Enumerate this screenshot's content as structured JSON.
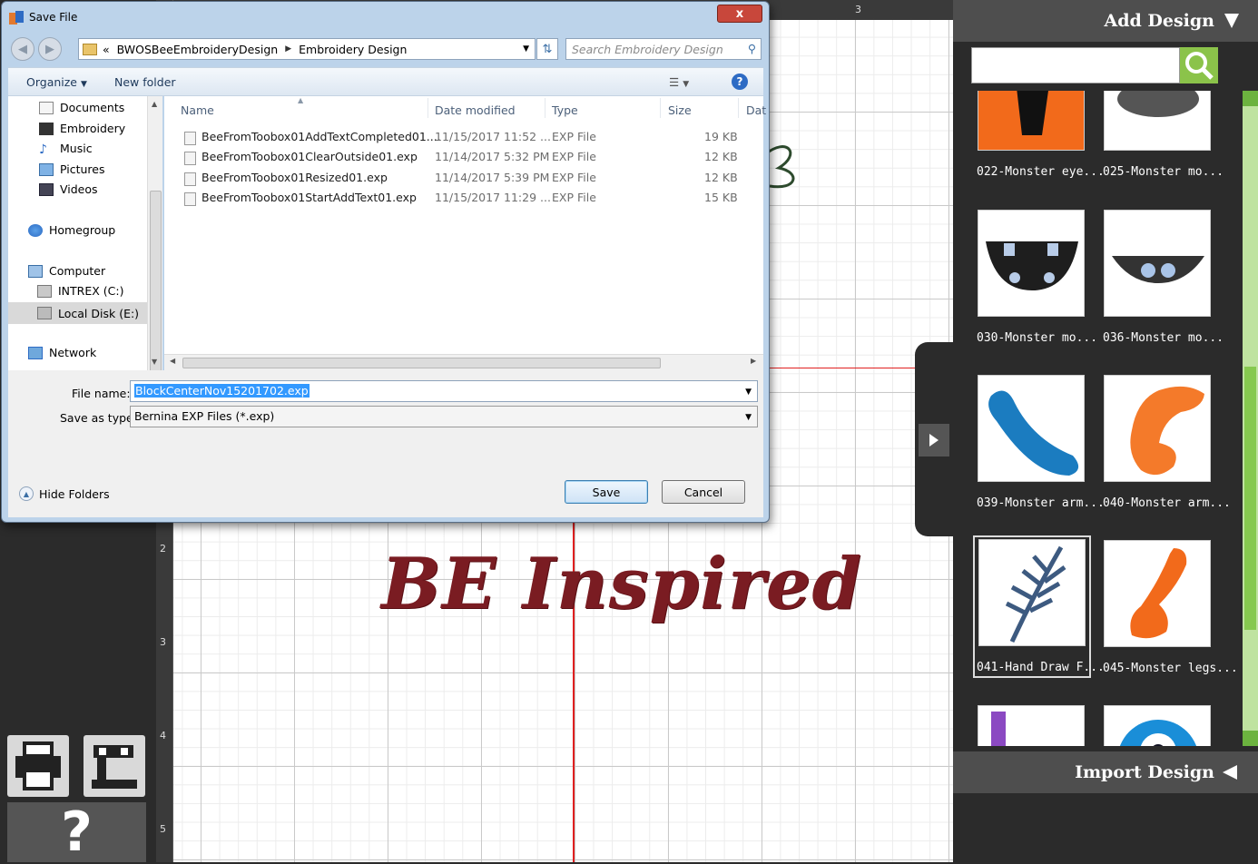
{
  "dialog": {
    "title": "Save File",
    "close_label": "x",
    "address": {
      "prefix": "«",
      "crumbs": [
        "BWOSBeeEmbroideryDesign",
        "Embroidery Design"
      ]
    },
    "search_placeholder": "Search Embroidery Design",
    "toolbar": {
      "organize": "Organize",
      "new_folder": "New folder"
    },
    "nav_items": [
      {
        "label": "Documents",
        "icon": "documents-icon"
      },
      {
        "label": "Embroidery",
        "icon": "embroidery-folder-icon"
      },
      {
        "label": "Music",
        "icon": "music-icon"
      },
      {
        "label": "Pictures",
        "icon": "pictures-icon"
      },
      {
        "label": "Videos",
        "icon": "videos-icon"
      },
      {
        "label": "Homegroup",
        "icon": "homegroup-icon"
      },
      {
        "label": "Computer",
        "icon": "computer-icon"
      },
      {
        "label": "INTREX (C:)",
        "icon": "drive-c-icon"
      },
      {
        "label": "Local Disk (E:)",
        "icon": "drive-e-icon"
      },
      {
        "label": "Network",
        "icon": "network-icon"
      }
    ],
    "columns": [
      "Name",
      "Date modified",
      "Type",
      "Size",
      "Dat"
    ],
    "files": [
      {
        "name": "BeeFromToobox01AddTextCompleted01....",
        "date": "11/15/2017 11:52 ...",
        "type": "EXP File",
        "size": "19 KB"
      },
      {
        "name": "BeeFromToobox01ClearOutside01.exp",
        "date": "11/14/2017 5:32 PM",
        "type": "EXP File",
        "size": "12 KB"
      },
      {
        "name": "BeeFromToobox01Resized01.exp",
        "date": "11/14/2017 5:39 PM",
        "type": "EXP File",
        "size": "12 KB"
      },
      {
        "name": "BeeFromToobox01StartAddText01.exp",
        "date": "11/15/2017 11:29 ...",
        "type": "EXP File",
        "size": "15 KB"
      }
    ],
    "file_name_label": "File name:",
    "file_name_value": "BlockCenterNov15201702.exp",
    "save_type_label": "Save as type:",
    "save_type_value": "Bernina EXP Files (*.exp)",
    "hide_folders": "Hide Folders",
    "save_button": "Save",
    "cancel_button": "Cancel"
  },
  "ruler": {
    "vertical_ticks": [
      "2",
      "3",
      "4",
      "5"
    ],
    "horizontal_ticks": [
      "3"
    ]
  },
  "canvas": {
    "text": "BE Inspired",
    "text_color": "#7a1c22"
  },
  "tools": {
    "help_label": "?"
  },
  "right_panel": {
    "add_design_title": "Add Design",
    "import_design_title": "Import Design",
    "search_value": "",
    "accent": "#8bc34a",
    "designs": [
      {
        "label": "022-Monster eye...",
        "icon": "monster-eye-design"
      },
      {
        "label": "025-Monster mo...",
        "icon": "monster-mouth-design"
      },
      {
        "label": "030-Monster mo...",
        "icon": "monster-mouth-teeth-design"
      },
      {
        "label": "036-Monster mo...",
        "icon": "monster-mouth-smile-design"
      },
      {
        "label": "039-Monster arm...",
        "icon": "monster-arm-blue-design"
      },
      {
        "label": "040-Monster arm...",
        "icon": "monster-arm-orange-design"
      },
      {
        "label": "041-Hand Draw F...",
        "icon": "hand-draw-fern-design"
      },
      {
        "label": "045-Monster legs...",
        "icon": "monster-legs-design"
      }
    ]
  }
}
